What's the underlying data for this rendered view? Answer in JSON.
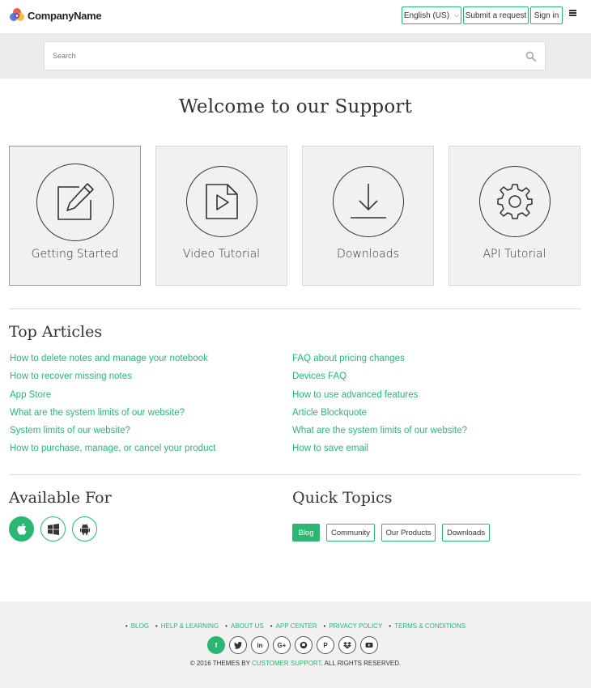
{
  "header": {
    "logo_text": "CompanyName",
    "language_label": "English (US)",
    "submit_label": "Submit a request",
    "signin_label": "Sign in"
  },
  "search": {
    "placeholder": "Search"
  },
  "welcome_title": "Welcome to our Support",
  "cards": [
    {
      "label": "Getting Started",
      "icon": "edit-icon"
    },
    {
      "label": "Video Tutorial",
      "icon": "video-file-icon"
    },
    {
      "label": "Downloads",
      "icon": "download-icon"
    },
    {
      "label": "API Tutorial",
      "icon": "gear-icon"
    }
  ],
  "top_articles": {
    "title": "Top Articles",
    "left": [
      "How to delete notes and manage your notebook",
      "How to recover missing notes",
      "App Store",
      "What are the system limits of our website?",
      "System limits of our website?",
      "How to purchase, manage, or cancel your product"
    ],
    "right": [
      "FAQ about pricing changes",
      "Devices FAQ",
      "How to use advanced features",
      "Article Blockquote",
      "What are the system limits of our website?",
      "How to save email"
    ]
  },
  "available_for": {
    "title": "Available For",
    "icons": [
      "apple-icon",
      "windows-icon",
      "android-icon"
    ]
  },
  "quick_topics": {
    "title": "Quick Topics",
    "tags": [
      "Blog",
      "Community",
      "Our Products",
      "Downloads"
    ]
  },
  "footer": {
    "links": [
      "BLOG",
      "HELP & LEARNING",
      "ABOUT US",
      "APP CENTER",
      "PRIVACY POLICY",
      "TERMS & CONDITIONS"
    ],
    "social": [
      "facebook-icon",
      "twitter-icon",
      "linkedin-icon",
      "google-plus-icon",
      "github-icon",
      "pinterest-icon",
      "dropbox-icon",
      "youtube-icon"
    ],
    "copyright_prefix": "© 2016 THEMES BY",
    "copyright_link": "CUSTOMER SUPPORT",
    "copyright_suffix": ". ALL RIGHTS RESERVED."
  },
  "colors": {
    "accent": "#2bb673",
    "band": "#ebebeb",
    "card_bg": "#f1f1f1"
  }
}
